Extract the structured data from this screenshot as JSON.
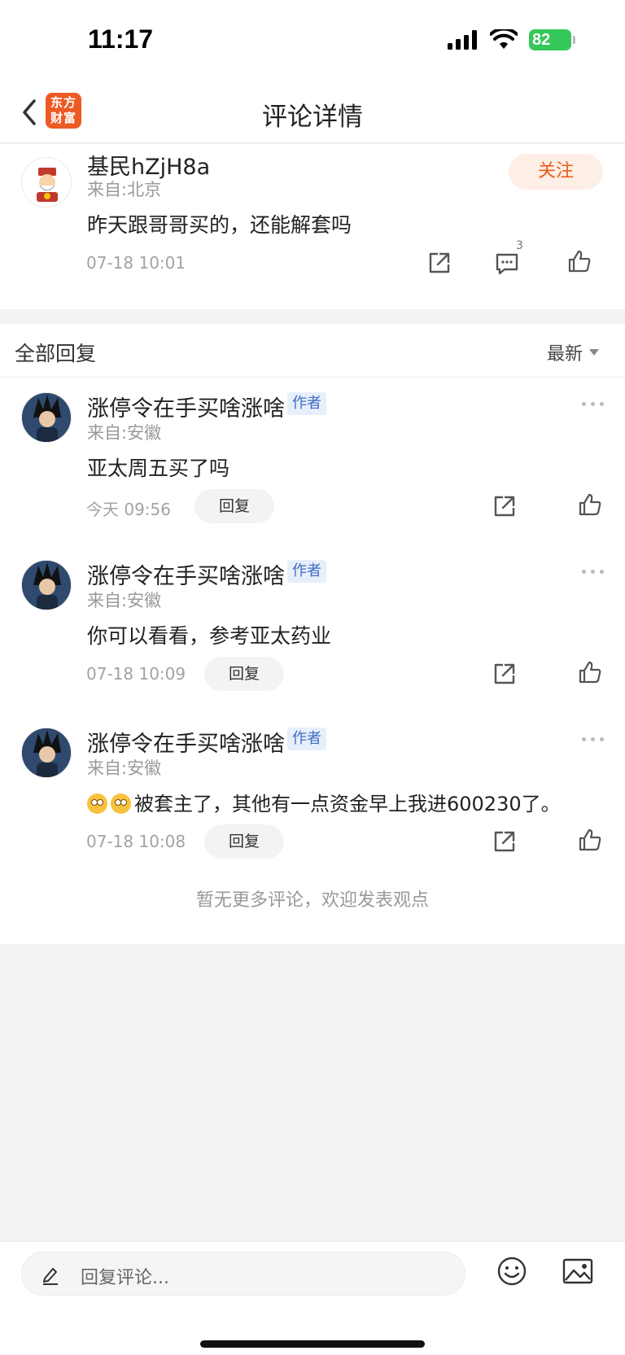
{
  "status_bar": {
    "time": "11:17",
    "battery": "82"
  },
  "nav": {
    "title": "评论详情",
    "logo_line1": "东方",
    "logo_line2": "财富"
  },
  "main_comment": {
    "author": "基民hZjH8a",
    "location": "来自:北京",
    "text": "昨天跟哥哥买的，还能解套吗",
    "timestamp": "07-18 10:01",
    "follow_label": "关注",
    "comment_count": "3"
  },
  "replies_header": {
    "title": "全部回复",
    "sort_label": "最新"
  },
  "replies": [
    {
      "author": "涨停令在手买啥涨啥",
      "tag": "作者",
      "location": "来自:安徽",
      "text": "亚太周五买了吗",
      "timestamp": "今天 09:56",
      "reply_label": "回复"
    },
    {
      "author": "涨停令在手买啥涨啥",
      "tag": "作者",
      "location": "来自:安徽",
      "text": "你可以看看，参考亚太药业",
      "timestamp": "07-18 10:09",
      "reply_label": "回复"
    },
    {
      "author": "涨停令在手买啥涨啥",
      "tag": "作者",
      "location": "来自:安徽",
      "text": "被套主了，其他有一点资金早上我进600230了。",
      "timestamp": "07-18 10:08",
      "reply_label": "回复"
    }
  ],
  "no_more_text": "暂无更多评论，欢迎发表观点",
  "bottom_bar": {
    "input_placeholder": "回复评论..."
  },
  "colors": {
    "accent": "#ec5a1a",
    "follow_bg": "#fdeee6",
    "tag_text": "#3c6dc4",
    "battery": "#35c759"
  }
}
